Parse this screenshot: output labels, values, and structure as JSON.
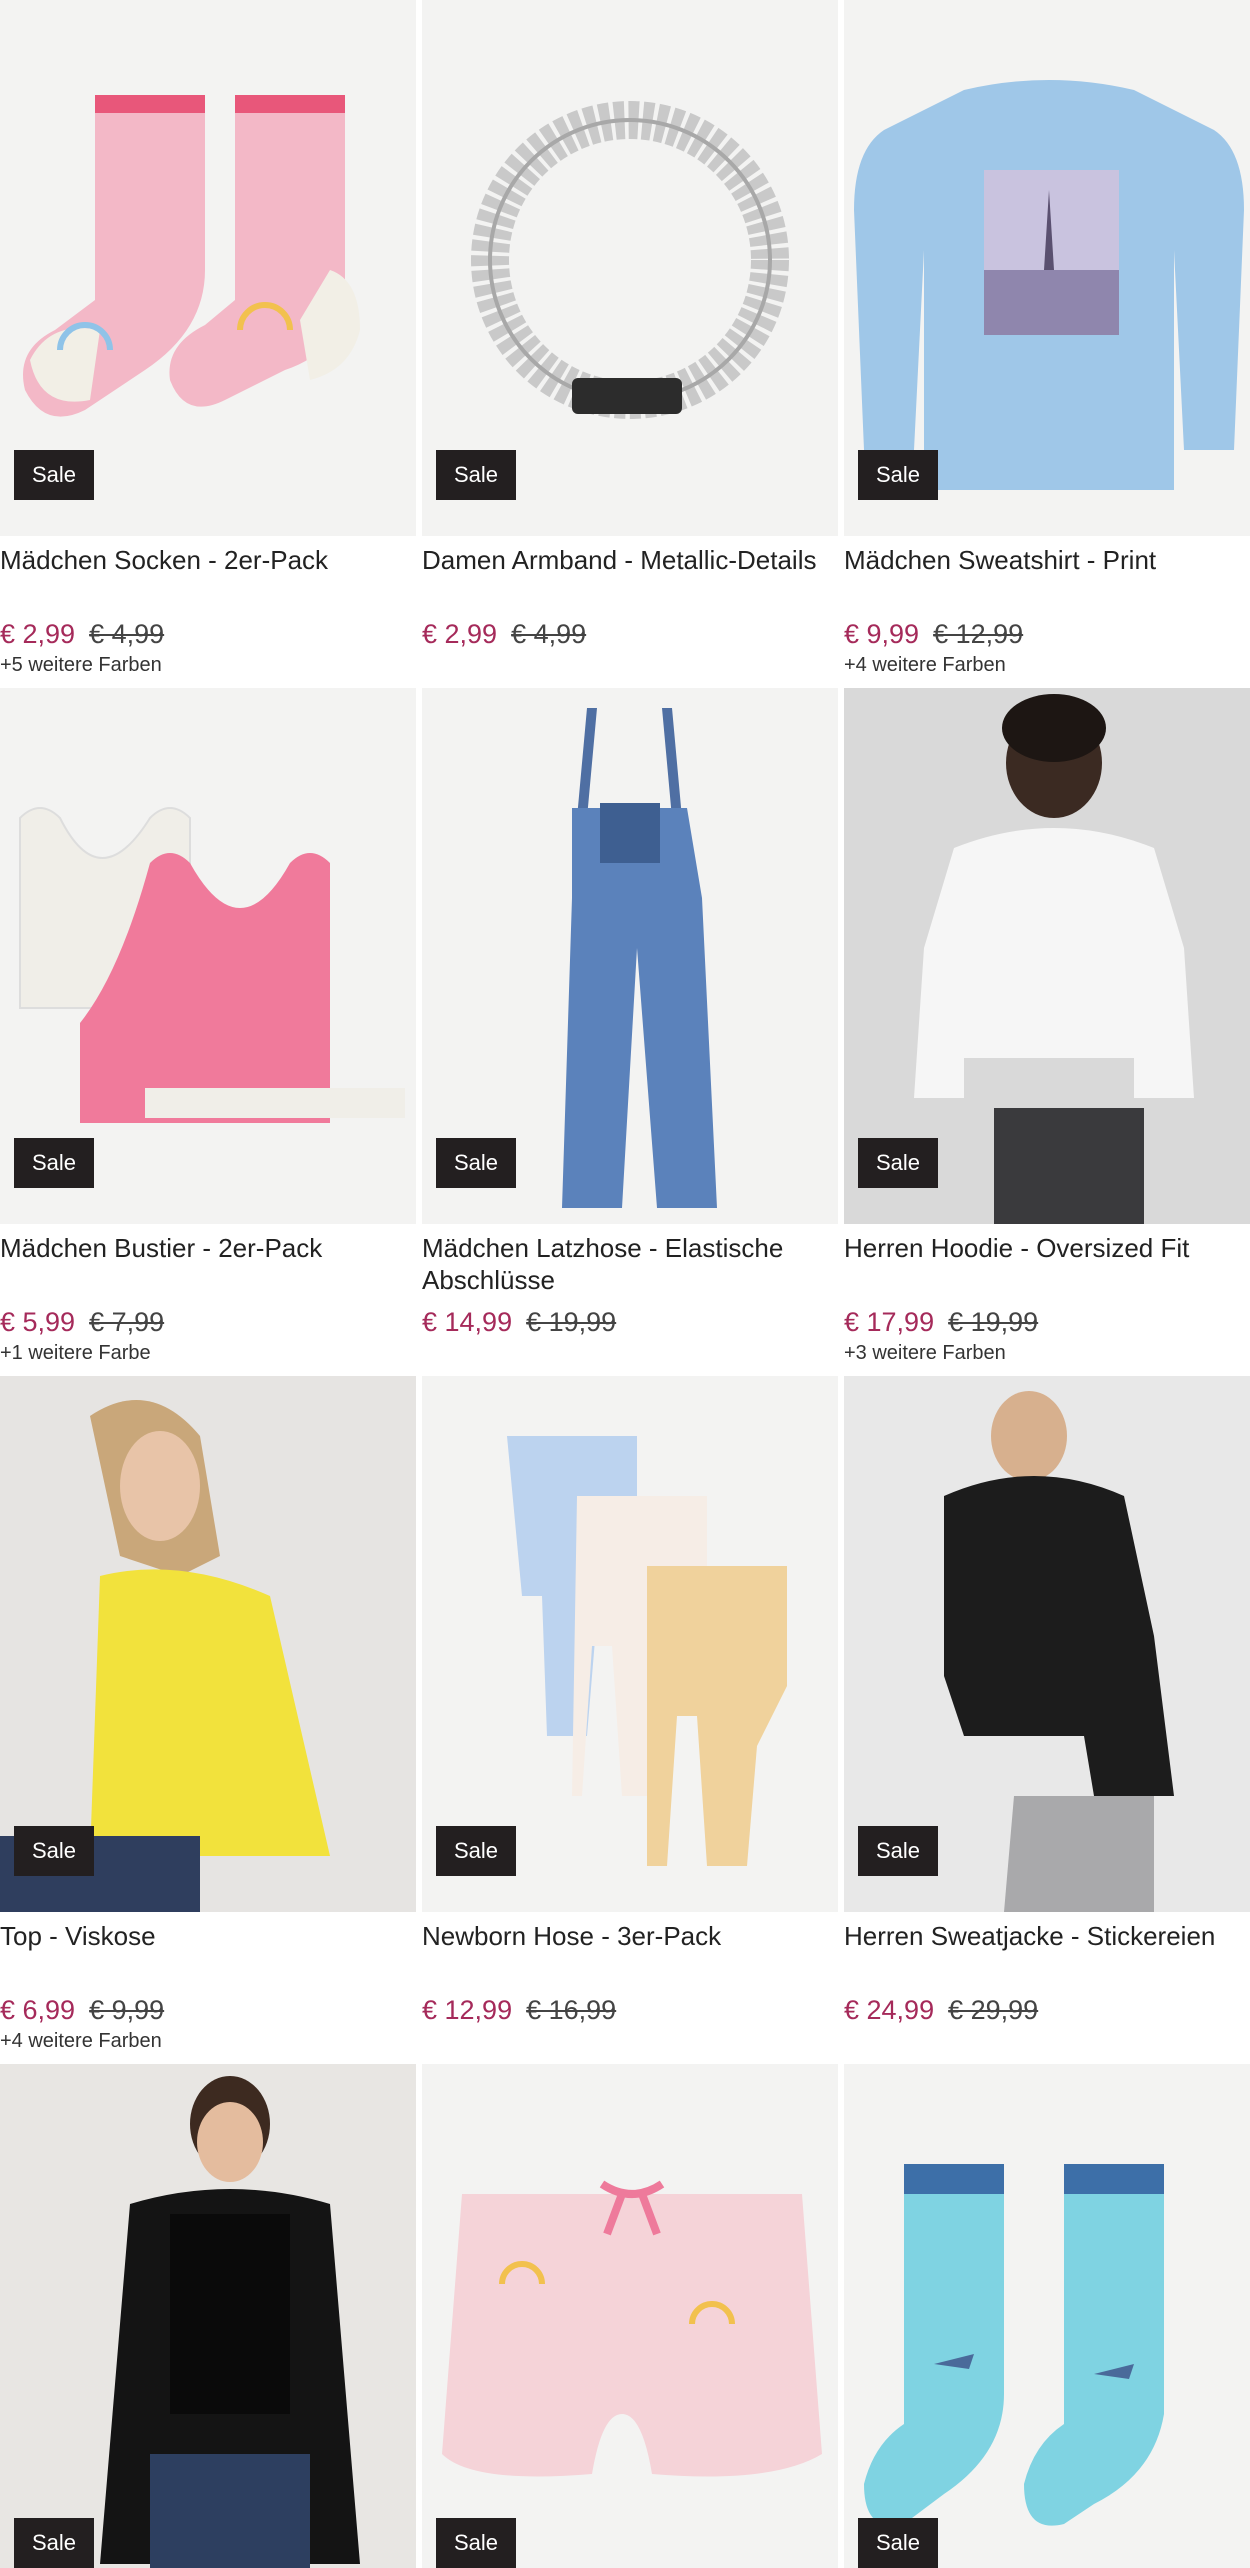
{
  "sale_label": "Sale",
  "products": [
    {
      "title": "Mädchen Socken - 2er-Pack",
      "price": "€ 2,99",
      "old_price": "€ 4,99",
      "colors": "+5 weitere Farben",
      "icon": "pink-socks-image"
    },
    {
      "title": "Damen Armband - Metallic-Details",
      "price": "€ 2,99",
      "old_price": "€ 4,99",
      "colors": "",
      "icon": "silver-bracelet-image"
    },
    {
      "title": "Mädchen Sweatshirt - Print",
      "price": "€ 9,99",
      "old_price": "€ 12,99",
      "colors": "+4 weitere Farben",
      "icon": "blue-sweatshirt-image"
    },
    {
      "title": "Mädchen Bustier - 2er-Pack",
      "price": "€ 5,99",
      "old_price": "€ 7,99",
      "colors": "+1 weitere Farbe",
      "icon": "bustier-image"
    },
    {
      "title": "Mädchen Latzhose - Elastische Abschlüsse",
      "price": "€ 14,99",
      "old_price": "€ 19,99",
      "colors": "",
      "icon": "denim-overall-image"
    },
    {
      "title": "Herren Hoodie - Oversized Fit",
      "price": "€ 17,99",
      "old_price": "€ 19,99",
      "colors": "+3 weitere Farben",
      "icon": "white-hoodie-image"
    },
    {
      "title": "Top - Viskose",
      "price": "€ 6,99",
      "old_price": "€ 9,99",
      "colors": "+4 weitere Farben",
      "icon": "yellow-top-image"
    },
    {
      "title": "Newborn Hose - 3er-Pack",
      "price": "€ 12,99",
      "old_price": "€ 16,99",
      "colors": "",
      "icon": "baby-pants-image"
    },
    {
      "title": "Herren Sweatjacke - Stickereien",
      "price": "€ 24,99",
      "old_price": "€ 29,99",
      "colors": "",
      "icon": "black-jacket-image"
    },
    {
      "title": "",
      "price": "",
      "old_price": "",
      "colors": "",
      "icon": "black-cardigan-image"
    },
    {
      "title": "",
      "price": "",
      "old_price": "",
      "colors": "",
      "icon": "pink-shorts-image"
    },
    {
      "title": "",
      "price": "",
      "old_price": "",
      "colors": "",
      "icon": "shark-socks-image"
    }
  ]
}
